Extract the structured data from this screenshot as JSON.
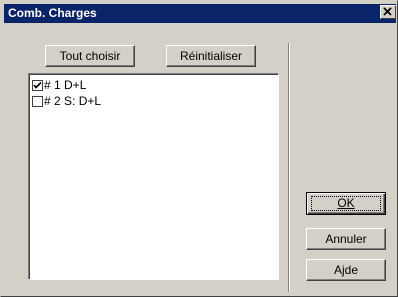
{
  "window": {
    "title": "Comb. Charges",
    "close_glyph": "✕"
  },
  "toolbar": {
    "select_all_label": "Tout choisir",
    "reset_label": "Réinitialiser"
  },
  "list": {
    "items": [
      {
        "label": "# 1  D+L",
        "checked": true
      },
      {
        "label": "# 2  S: D+L",
        "checked": false
      }
    ]
  },
  "actions": {
    "ok_label": "OK",
    "cancel_label": "Annuler",
    "help_label": "Ajde"
  }
}
